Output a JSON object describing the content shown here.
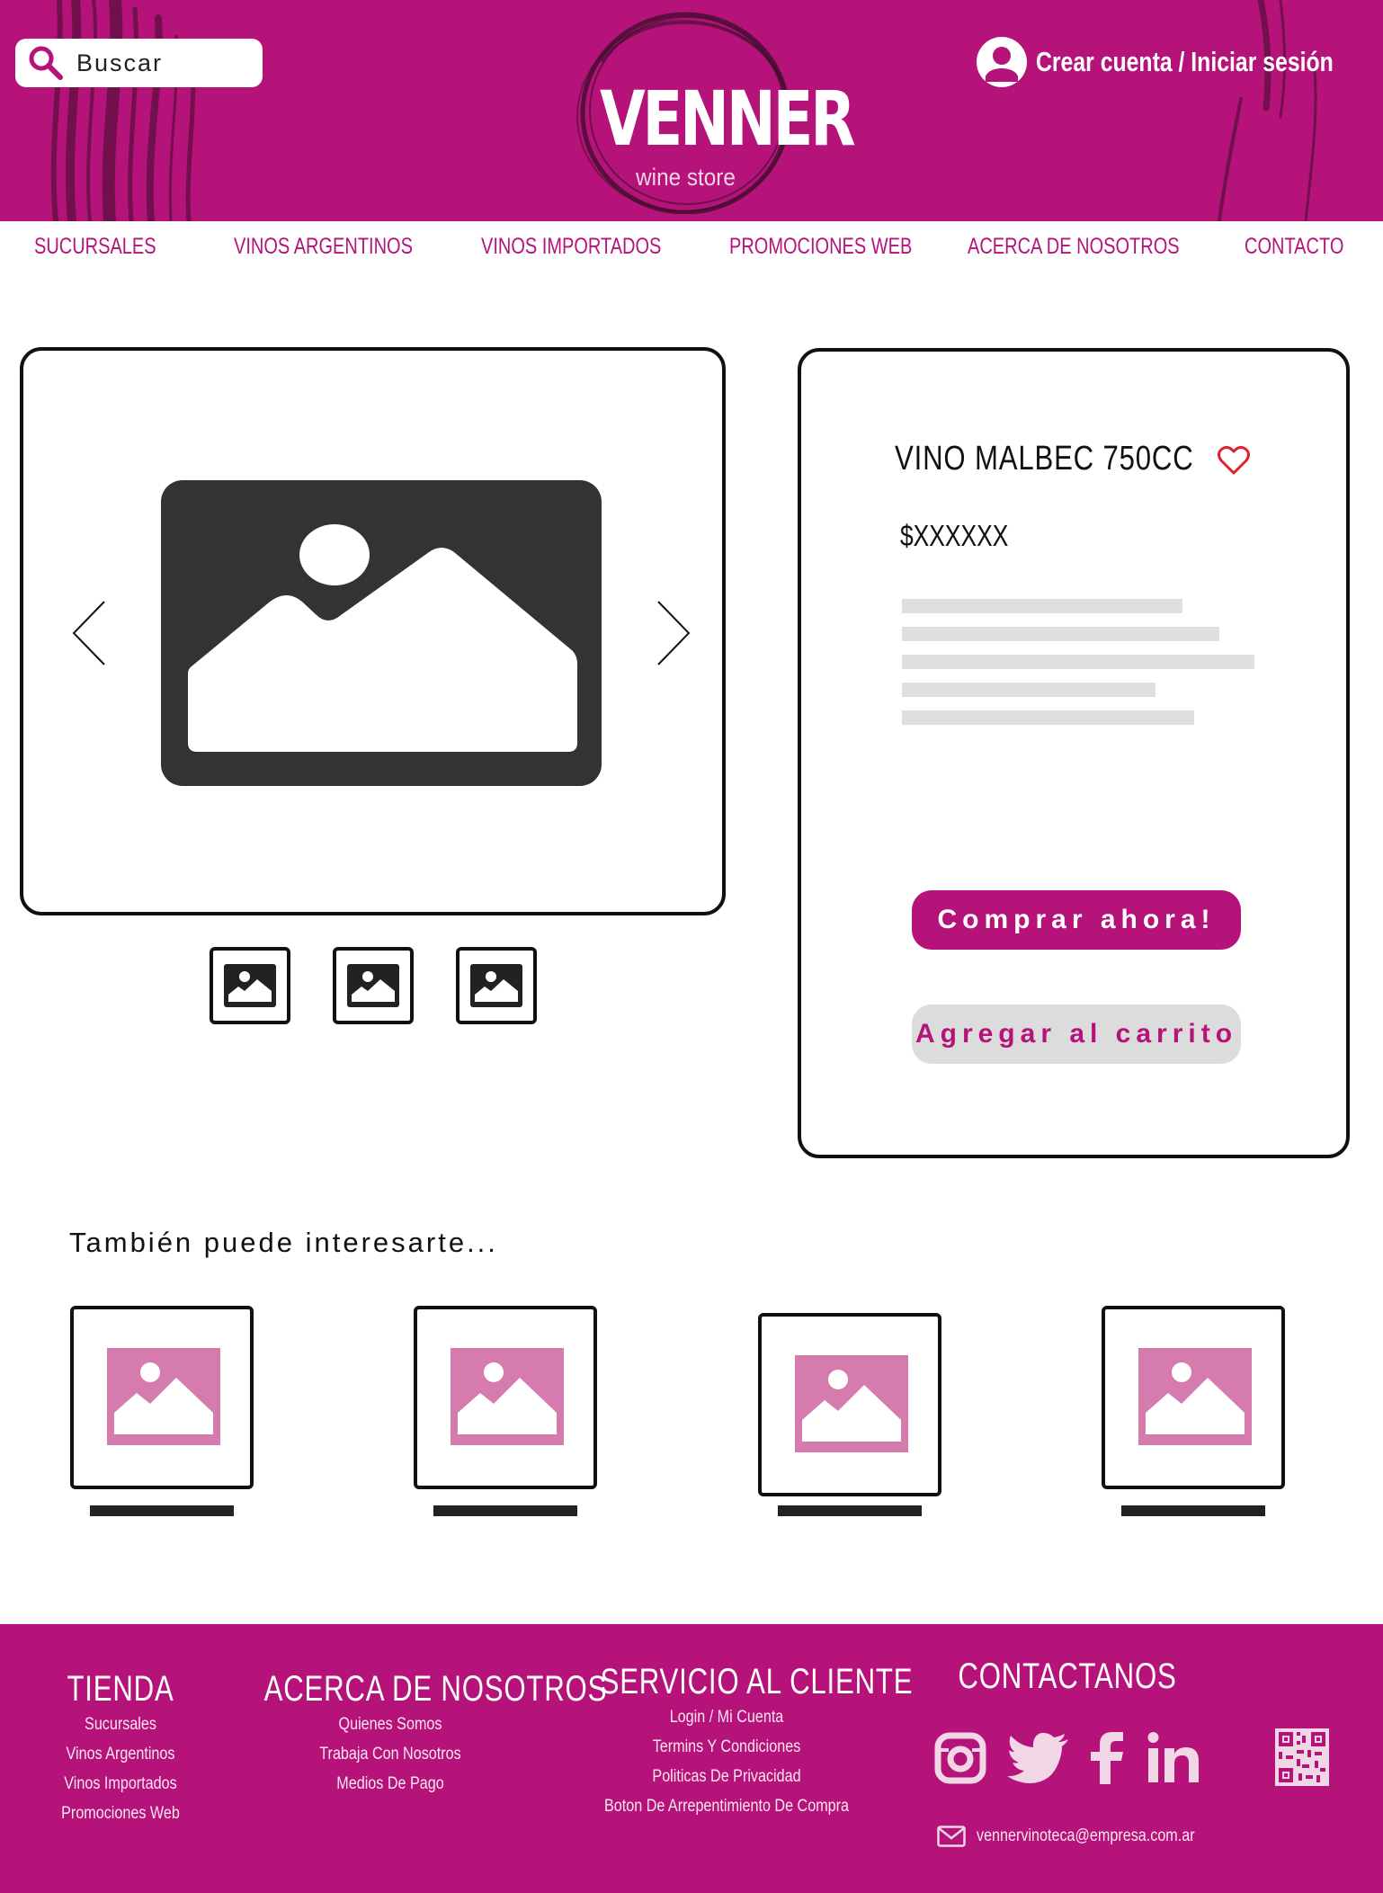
{
  "header": {
    "search_placeholder": "Buscar",
    "logo_name": "VENNER",
    "logo_tagline": "wine store",
    "account_link": "Crear cuenta / Iniciar sesión"
  },
  "nav": {
    "items": [
      "SUCURSALES",
      "VINOS ARGENTINOS",
      "VINOS IMPORTADOS",
      "PROMOCIONES WEB",
      "ACERCA DE NOSOTROS",
      "CONTACTO"
    ]
  },
  "product": {
    "title": "VINO MALBEC 750CC",
    "price": "$XXXXXX",
    "buy_label": "Comprar ahora!",
    "cart_label": "Agregar al carrito"
  },
  "recommendations": {
    "title": "También puede interesarte..."
  },
  "footer": {
    "tienda": {
      "title": "TIENDA",
      "links": [
        "Sucursales",
        "Vinos Argentinos",
        "Vinos Importados",
        "Promociones Web"
      ]
    },
    "acerca": {
      "title": "ACERCA DE  NOSOTROS",
      "links": [
        "Quienes Somos",
        "Trabaja Con Nosotros",
        "Medios De Pago"
      ]
    },
    "servicio": {
      "title": "SERVICIO AL CLIENTE",
      "links": [
        "Login / Mi Cuenta",
        "Termins Y Condiciones",
        "Politicas De Privacidad",
        "Boton De Arrepentimiento De Compra"
      ]
    },
    "contacto": {
      "title": "CONTACTANOS",
      "email": "vennervinoteca@empresa.com.ar",
      "social_icons": [
        "instagram-icon",
        "twitter-icon",
        "facebook-icon",
        "linkedin-icon"
      ]
    }
  },
  "colors": {
    "brand": "#b5127a",
    "placeholder_pink": "#d67bad",
    "skeleton": "#dde0df",
    "heart": "#e0202a"
  }
}
